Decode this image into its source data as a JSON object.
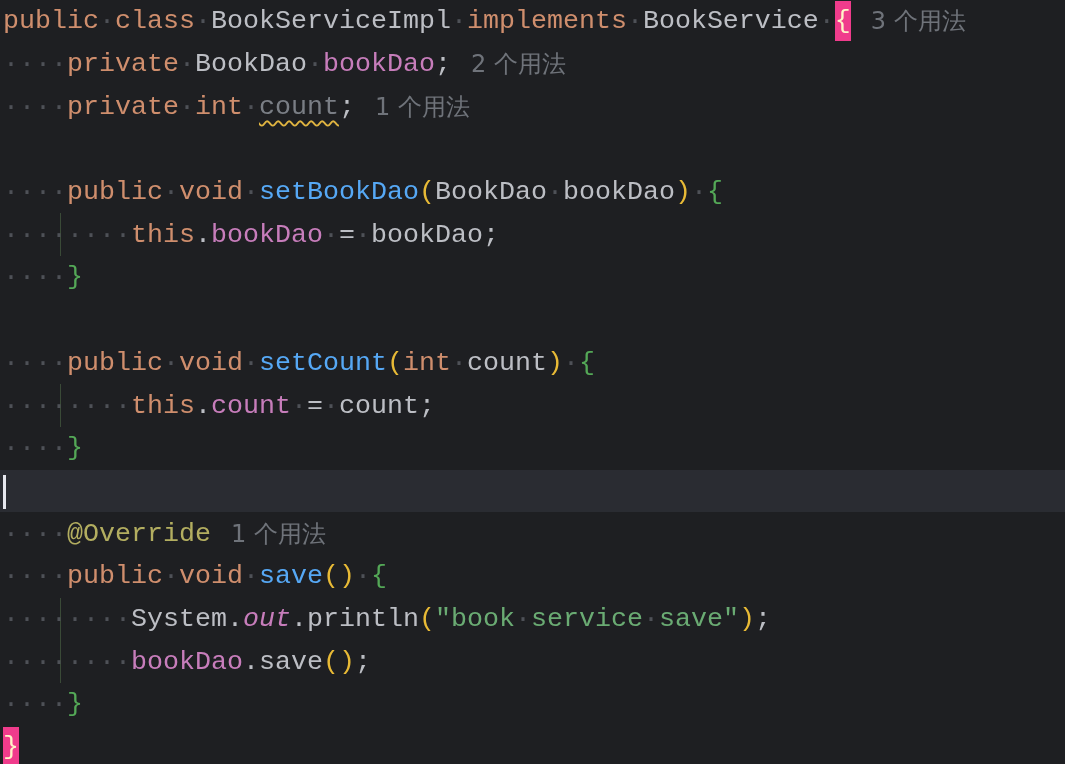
{
  "editor": {
    "lines": [
      {
        "current": false,
        "guide": false,
        "tokens": [
          {
            "kind": "keyword",
            "text": "public"
          },
          {
            "kind": "space",
            "text": "·"
          },
          {
            "kind": "keyword",
            "text": "class"
          },
          {
            "kind": "space",
            "text": "·"
          },
          {
            "kind": "plain",
            "text": "BookServiceImpl"
          },
          {
            "kind": "space",
            "text": "·"
          },
          {
            "kind": "keyword",
            "text": "implements"
          },
          {
            "kind": "space",
            "text": "·"
          },
          {
            "kind": "plain",
            "text": "BookService"
          },
          {
            "kind": "space",
            "text": "·"
          },
          {
            "kind": "match",
            "text": "{"
          }
        ],
        "hint": "3 个用法"
      },
      {
        "current": false,
        "guide": false,
        "indent": "····",
        "tokens": [
          {
            "kind": "keyword",
            "text": "private"
          },
          {
            "kind": "space",
            "text": "·"
          },
          {
            "kind": "plain",
            "text": "BookDao"
          },
          {
            "kind": "space",
            "text": "·"
          },
          {
            "kind": "field",
            "text": "bookDao"
          },
          {
            "kind": "plain",
            "text": ";"
          }
        ],
        "hint": "2 个用法"
      },
      {
        "current": false,
        "guide": false,
        "indent": "····",
        "tokens": [
          {
            "kind": "keyword",
            "text": "private"
          },
          {
            "kind": "space",
            "text": "·"
          },
          {
            "kind": "keyword",
            "text": "int"
          },
          {
            "kind": "space",
            "text": "·"
          },
          {
            "kind": "unused",
            "text": "count"
          },
          {
            "kind": "plain",
            "text": ";"
          }
        ],
        "hint": "1 个用法"
      },
      {
        "current": false,
        "guide": false
      },
      {
        "current": false,
        "guide": false,
        "indent": "····",
        "tokens": [
          {
            "kind": "keyword",
            "text": "public"
          },
          {
            "kind": "space",
            "text": "·"
          },
          {
            "kind": "keyword",
            "text": "void"
          },
          {
            "kind": "space",
            "text": "·"
          },
          {
            "kind": "method",
            "text": "setBookDao"
          },
          {
            "kind": "paren",
            "text": "("
          },
          {
            "kind": "plain",
            "text": "BookDao"
          },
          {
            "kind": "space",
            "text": "·"
          },
          {
            "kind": "plain",
            "text": "bookDao"
          },
          {
            "kind": "paren",
            "text": ")"
          },
          {
            "kind": "space",
            "text": "·"
          },
          {
            "kind": "brace",
            "text": "{"
          }
        ]
      },
      {
        "current": false,
        "guide": true,
        "indent": "····",
        "tokens": [
          {
            "kind": "space",
            "text": "····"
          },
          {
            "kind": "keyword",
            "text": "this"
          },
          {
            "kind": "plain",
            "text": "."
          },
          {
            "kind": "field",
            "text": "bookDao"
          },
          {
            "kind": "space",
            "text": "·"
          },
          {
            "kind": "plain",
            "text": "="
          },
          {
            "kind": "space",
            "text": "·"
          },
          {
            "kind": "plain",
            "text": "bookDao;"
          }
        ]
      },
      {
        "current": false,
        "guide": false,
        "indent": "····",
        "tokens": [
          {
            "kind": "brace",
            "text": "}"
          }
        ]
      },
      {
        "current": false,
        "guide": false
      },
      {
        "current": false,
        "guide": false,
        "indent": "····",
        "tokens": [
          {
            "kind": "keyword",
            "text": "public"
          },
          {
            "kind": "space",
            "text": "·"
          },
          {
            "kind": "keyword",
            "text": "void"
          },
          {
            "kind": "space",
            "text": "·"
          },
          {
            "kind": "method",
            "text": "setCount"
          },
          {
            "kind": "paren",
            "text": "("
          },
          {
            "kind": "keyword",
            "text": "int"
          },
          {
            "kind": "space",
            "text": "·"
          },
          {
            "kind": "plain",
            "text": "count"
          },
          {
            "kind": "paren",
            "text": ")"
          },
          {
            "kind": "space",
            "text": "·"
          },
          {
            "kind": "brace",
            "text": "{"
          }
        ]
      },
      {
        "current": false,
        "guide": true,
        "indent": "····",
        "tokens": [
          {
            "kind": "space",
            "text": "····"
          },
          {
            "kind": "keyword",
            "text": "this"
          },
          {
            "kind": "plain",
            "text": "."
          },
          {
            "kind": "field",
            "text": "count"
          },
          {
            "kind": "space",
            "text": "·"
          },
          {
            "kind": "plain",
            "text": "="
          },
          {
            "kind": "space",
            "text": "·"
          },
          {
            "kind": "plain",
            "text": "count;"
          }
        ]
      },
      {
        "current": false,
        "guide": false,
        "indent": "····",
        "tokens": [
          {
            "kind": "brace",
            "text": "}"
          }
        ]
      },
      {
        "current": true,
        "guide": false
      },
      {
        "current": false,
        "guide": false,
        "indent": "····",
        "tokens": [
          {
            "kind": "annotation",
            "text": "@Override"
          }
        ],
        "hint": "1 个用法"
      },
      {
        "current": false,
        "guide": false,
        "indent": "····",
        "tokens": [
          {
            "kind": "keyword",
            "text": "public"
          },
          {
            "kind": "space",
            "text": "·"
          },
          {
            "kind": "keyword",
            "text": "void"
          },
          {
            "kind": "space",
            "text": "·"
          },
          {
            "kind": "method",
            "text": "save"
          },
          {
            "kind": "paren",
            "text": "()"
          },
          {
            "kind": "space",
            "text": "·"
          },
          {
            "kind": "brace",
            "text": "{"
          }
        ]
      },
      {
        "current": false,
        "guide": true,
        "indent": "····",
        "tokens": [
          {
            "kind": "space",
            "text": "····"
          },
          {
            "kind": "plain",
            "text": "System."
          },
          {
            "kind": "static",
            "text": "out"
          },
          {
            "kind": "plain",
            "text": ".println"
          },
          {
            "kind": "paren",
            "text": "("
          },
          {
            "kind": "string",
            "text": "\"book"
          },
          {
            "kind": "space",
            "text": "·"
          },
          {
            "kind": "string",
            "text": "service"
          },
          {
            "kind": "space",
            "text": "·"
          },
          {
            "kind": "string",
            "text": "save\""
          },
          {
            "kind": "paren",
            "text": ")"
          },
          {
            "kind": "plain",
            "text": ";"
          }
        ]
      },
      {
        "current": false,
        "guide": true,
        "indent": "····",
        "tokens": [
          {
            "kind": "space",
            "text": "····"
          },
          {
            "kind": "field",
            "text": "bookDao"
          },
          {
            "kind": "plain",
            "text": ".save"
          },
          {
            "kind": "paren",
            "text": "()"
          },
          {
            "kind": "plain",
            "text": ";"
          }
        ]
      },
      {
        "current": false,
        "guide": false,
        "indent": "····",
        "tokens": [
          {
            "kind": "brace",
            "text": "}"
          }
        ]
      },
      {
        "current": false,
        "guide": false,
        "tokens": [
          {
            "kind": "match",
            "text": "}"
          }
        ]
      }
    ]
  }
}
